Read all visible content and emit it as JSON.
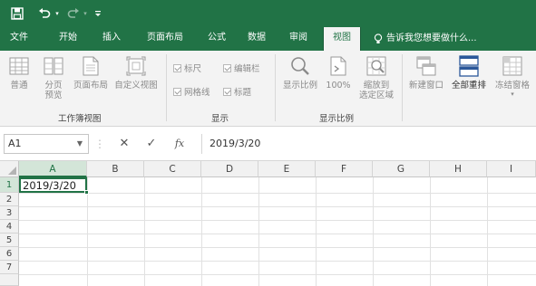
{
  "quick_access": {
    "save_icon": "save-icon",
    "undo_icon": "undo-icon",
    "redo_icon": "redo-icon",
    "customize_icon": "customize-qat-icon"
  },
  "tabs": [
    "文件",
    "开始",
    "插入",
    "页面布局",
    "公式",
    "数据",
    "审阅",
    "视图"
  ],
  "active_tab": "视图",
  "tell_me": "告诉我您想要做什么...",
  "ribbon": {
    "workbook_views": {
      "label": "工作簿视图",
      "buttons": [
        "普通",
        "分页\n预览",
        "页面布局",
        "自定义视图"
      ]
    },
    "show": {
      "label": "显示",
      "checkboxes": [
        "标尺",
        "编辑栏",
        "网格线",
        "标题"
      ]
    },
    "zoom": {
      "label": "显示比例",
      "buttons": [
        "显示比例",
        "100%",
        "缩放到\n选定区域"
      ]
    },
    "window": {
      "buttons": [
        "新建窗口",
        "全部重排",
        "冻结窗格"
      ]
    }
  },
  "formula_bar": {
    "name_box": "A1",
    "cancel_symbol": "✕",
    "enter_symbol": "✓",
    "fx_symbol": "fx",
    "content": "2019/3/20"
  },
  "grid": {
    "columns": [
      "A",
      "B",
      "C",
      "D",
      "E",
      "F",
      "G",
      "H",
      "I"
    ],
    "rows": [
      "1",
      "2",
      "3",
      "4",
      "5",
      "6",
      "7"
    ],
    "selected_cell": "A1",
    "cells": {
      "A1": "2019/3/20"
    }
  },
  "colors": {
    "brand": "#217346",
    "selected_header": "#d3e5d8"
  }
}
